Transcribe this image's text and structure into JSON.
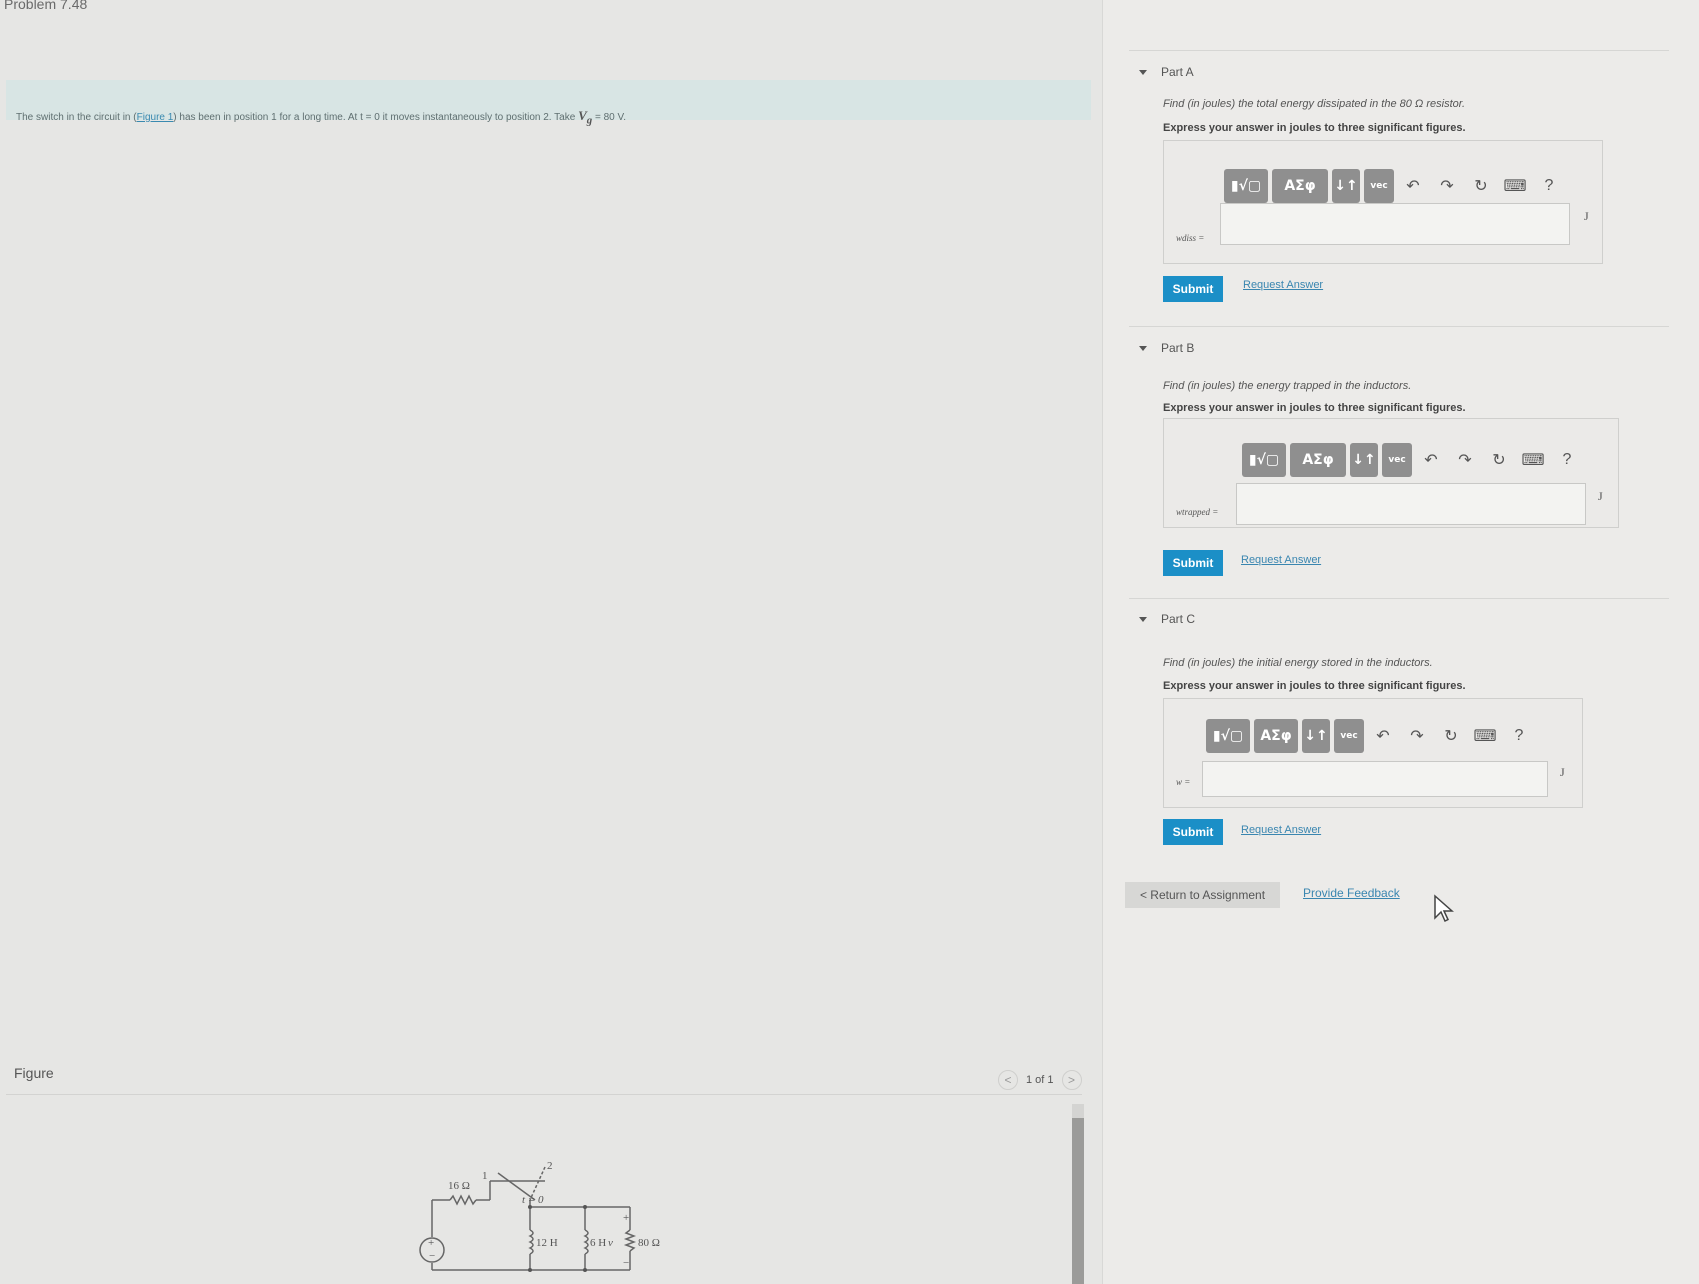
{
  "problem": {
    "title": "Problem 7.48",
    "text_prefix": "The switch in the circuit in",
    "figure_link": "Figure 1",
    "text_suffix": "has been in position 1 for a long time. At t = 0 it moves instantaneously to position 2. Take",
    "vg_label": "V",
    "vg_value": "= 80 V."
  },
  "figure": {
    "label": "Figure",
    "pager": "1 of 1",
    "prev": "<",
    "next": ">",
    "circuit": {
      "vg": "V",
      "r1": "16 Ω",
      "sw_pos1": "1",
      "sw_pos2": "2",
      "sw_time": "t = 0",
      "l1": "12 H",
      "l2": "6 H",
      "vo": "v",
      "plus": "+",
      "minus": "−",
      "r2": "80 Ω"
    }
  },
  "toolbar": {
    "templates": "▮√▢",
    "greek": "ΑΣφ",
    "arrows": "↓↑",
    "vec": "vec",
    "undo": "↶",
    "redo": "↷",
    "reset": "↻",
    "keyboard": "⌨",
    "help": "?"
  },
  "parts": [
    {
      "header": "Part A",
      "question": "Find (in joules) the total energy dissipated in the 80 Ω resistor.",
      "instruction": "Express your answer in joules to three significant figures.",
      "label": "wdiss =",
      "unit": "J",
      "submit": "Submit",
      "request": "Request Answer"
    },
    {
      "header": "Part B",
      "question": "Find (in joules) the energy trapped in the inductors.",
      "instruction": "Express your answer in joules to three significant figures.",
      "label": "wtrapped =",
      "unit": "J",
      "submit": "Submit",
      "request": "Request Answer"
    },
    {
      "header": "Part C",
      "question": "Find (in joules) the initial energy stored in the inductors.",
      "instruction": "Express your answer in joules to three significant figures.",
      "label": "w =",
      "unit": "J",
      "submit": "Submit",
      "request": "Request Answer"
    }
  ],
  "footer": {
    "return": "< Return to Assignment",
    "feedback": "Provide Feedback"
  }
}
